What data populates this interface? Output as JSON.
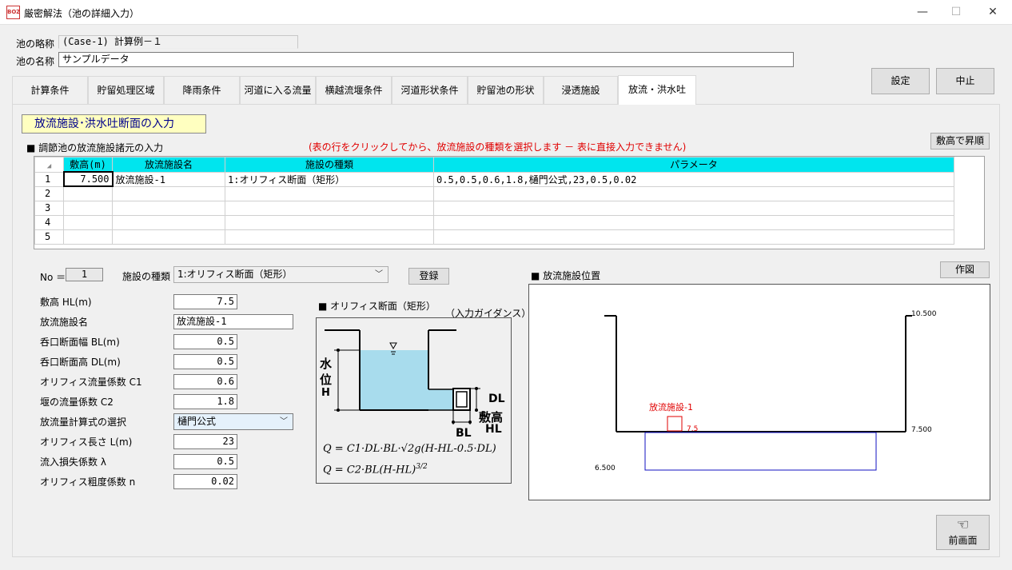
{
  "window": {
    "title": "厳密解法（池の詳細入力）",
    "icon_text": "BOZ",
    "minimize": "—",
    "maximize": "☐",
    "close": "✕"
  },
  "pond": {
    "abbr_label": "池の略称",
    "abbr_value": "(Case-1) 計算例－１",
    "name_label": "池の名称",
    "name_value": "サンプルデータ"
  },
  "buttons": {
    "settings": "設定",
    "cancel": "中止",
    "sort": "敷高で昇順",
    "register": "登録",
    "draw": "作図",
    "prev": "前画面"
  },
  "tabs": [
    {
      "label": "計算条件"
    },
    {
      "label": "貯留処理区域"
    },
    {
      "label": "降雨条件"
    },
    {
      "label": "河道に入る流量"
    },
    {
      "label": "横越流堰条件"
    },
    {
      "label": "河道形状条件"
    },
    {
      "label": "貯留池の形状"
    },
    {
      "label": "浸透施設"
    },
    {
      "label": "放流・洪水吐"
    }
  ],
  "section": {
    "title": "放流施設･洪水吐断面の入力",
    "grid_title": "■ 調節池の放流施設諸元の入力",
    "notice": "(表の行をクリックしてから、放流施設の種類を選択します － 表に直接入力できません)"
  },
  "grid": {
    "headers": [
      "敷高(m)",
      "放流施設名",
      "施設の種類",
      "パラメータ"
    ],
    "rows": [
      {
        "no": "1",
        "height": "7.500",
        "name": "放流施設-1",
        "type": "1:オリフィス断面（矩形）",
        "params": "0.5,0.5,0.6,1.8,樋門公式,23,0.5,0.02"
      },
      {
        "no": "2",
        "height": "",
        "name": "",
        "type": "",
        "params": ""
      },
      {
        "no": "3",
        "height": "",
        "name": "",
        "type": "",
        "params": ""
      },
      {
        "no": "4",
        "height": "",
        "name": "",
        "type": "",
        "params": ""
      },
      {
        "no": "5",
        "height": "",
        "name": "",
        "type": "",
        "params": ""
      }
    ]
  },
  "form": {
    "no_label": "No ＝",
    "no_value": "1",
    "type_label": "施設の種類",
    "type_value": "1:オリフィス断面（矩形）",
    "fields": [
      {
        "label": "敷高 HL(m)",
        "value": "7.5"
      },
      {
        "label": "放流施設名",
        "value": "放流施設-1"
      },
      {
        "label": "呑口断面幅 BL(m)",
        "value": "0.5"
      },
      {
        "label": "呑口断面高 DL(m)",
        "value": "0.5"
      },
      {
        "label": "オリフィス流量係数 C1",
        "value": "0.6"
      },
      {
        "label": "堰の流量係数 C2",
        "value": "1.8"
      },
      {
        "label": "放流量計算式の選択",
        "value": "樋門公式"
      },
      {
        "label": "オリフィス長さ L(m)",
        "value": "23"
      },
      {
        "label": "流入損失係数 λ",
        "value": "0.5"
      },
      {
        "label": "オリフィス粗度係数 n",
        "value": "0.02"
      }
    ]
  },
  "guide": {
    "title": "■ オリフィス断面（矩形）",
    "subtitle": "（入力ガイダンス）",
    "h_label_1": "水",
    "h_label_2": "位",
    "h_label_3": "H",
    "dl": "DL",
    "hl_1": "敷高",
    "hl_2": "HL",
    "bl": "BL",
    "formula1": "Q = C1·DL·BL·√2g(H-HL-0.5·DL)",
    "formula2": "Q = C2·BL(H-HL)",
    "formula2_exp": "3/2"
  },
  "position": {
    "title": "■ 放流施設位置",
    "top_level": "10.500",
    "mid_level": "7.500",
    "bottom_level": "6.500",
    "facility_label": "放流施設-1",
    "facility_value": "7.5"
  }
}
